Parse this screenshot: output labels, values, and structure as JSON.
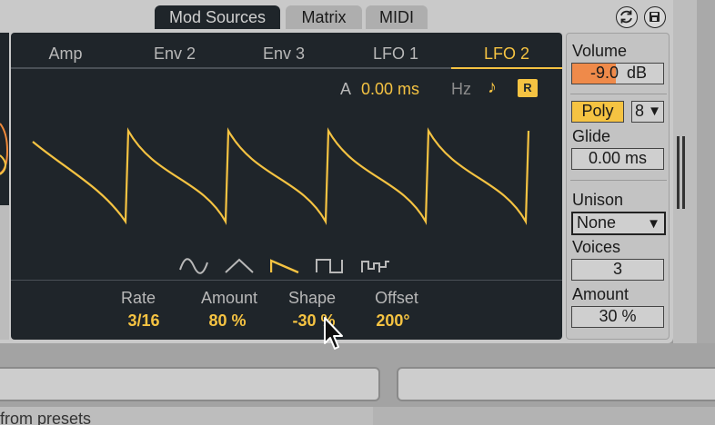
{
  "tabs": {
    "mod_sources": "Mod Sources",
    "matrix": "Matrix",
    "midi": "MIDI"
  },
  "mod_tabs": [
    "Amp",
    "Env 2",
    "Env 3",
    "LFO 1",
    "LFO 2"
  ],
  "active_mod_tab": "LFO 2",
  "lfo": {
    "attack_label": "A",
    "attack_value": "0.00 ms",
    "hz_label": "Hz",
    "note_icon": "♪",
    "retrigger_label": "R",
    "shapes": [
      "sine-wave-icon",
      "triangle-wave-icon",
      "saw-wave-icon",
      "square-wave-icon",
      "random-wave-icon"
    ],
    "selected_shape": "saw-wave-icon",
    "params": [
      {
        "label": "Rate",
        "value": "3/16"
      },
      {
        "label": "Amount",
        "value": "80 %"
      },
      {
        "label": "Shape",
        "value": "-30 %"
      },
      {
        "label": "Offset",
        "value": "200°"
      }
    ]
  },
  "side": {
    "volume_label": "Volume",
    "volume_value": "-9.0",
    "volume_unit": "dB",
    "volume_fill": 0.48,
    "poly_label": "Poly",
    "voices_select": "8",
    "glide_label": "Glide",
    "glide_value": "0.00 ms",
    "unison_label": "Unison",
    "unison_value": "None",
    "voices_label": "Voices",
    "voices_value": "3",
    "amount_label": "Amount",
    "amount_value": "30 %"
  },
  "colors": {
    "accent": "#f5c342",
    "panel": "#1f252a",
    "volume_fill": "#ef8a4a"
  },
  "bottom_text": "from presets"
}
